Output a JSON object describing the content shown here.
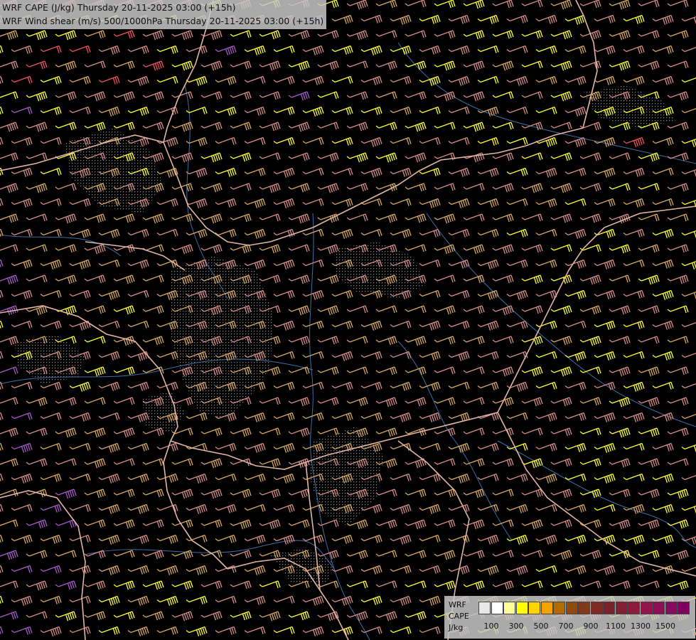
{
  "title": {
    "line1": "WRF CAPE (J/kg) Thursday 20-11-2025 03:00 (+15h)",
    "line2": "WRF Wind shear (m/s) 500/1000hPa Thursday 20-11-2025 03:00 (+15h)"
  },
  "legend": {
    "line1": "WRF",
    "line2": "CAPE",
    "line3": "J/kg",
    "colors": [
      "#e8e8e8",
      "#ffffff",
      "#ffff9a",
      "#ffff00",
      "#ffd400",
      "#f5a300",
      "#b36a00",
      "#8f4a0e",
      "#80391a",
      "#7e2a24",
      "#7a222c",
      "#812035",
      "#8c1a3e",
      "#92144a",
      "#8f0f56",
      "#860b5e",
      "#80005f"
    ],
    "ticks": [
      "100",
      "300",
      "500",
      "700",
      "900",
      "1100",
      "1300",
      "1500"
    ]
  },
  "map_style": {
    "barb_colors": {
      "tan": "#d7a766",
      "pink": "#d58e86",
      "yellow": "#ffff33",
      "violet": "#a559c6",
      "red": "#f0505a"
    },
    "border_color": "#e3b5a5",
    "river_color": "#3d6fa8",
    "stipple_color": "#8a8a8a"
  }
}
